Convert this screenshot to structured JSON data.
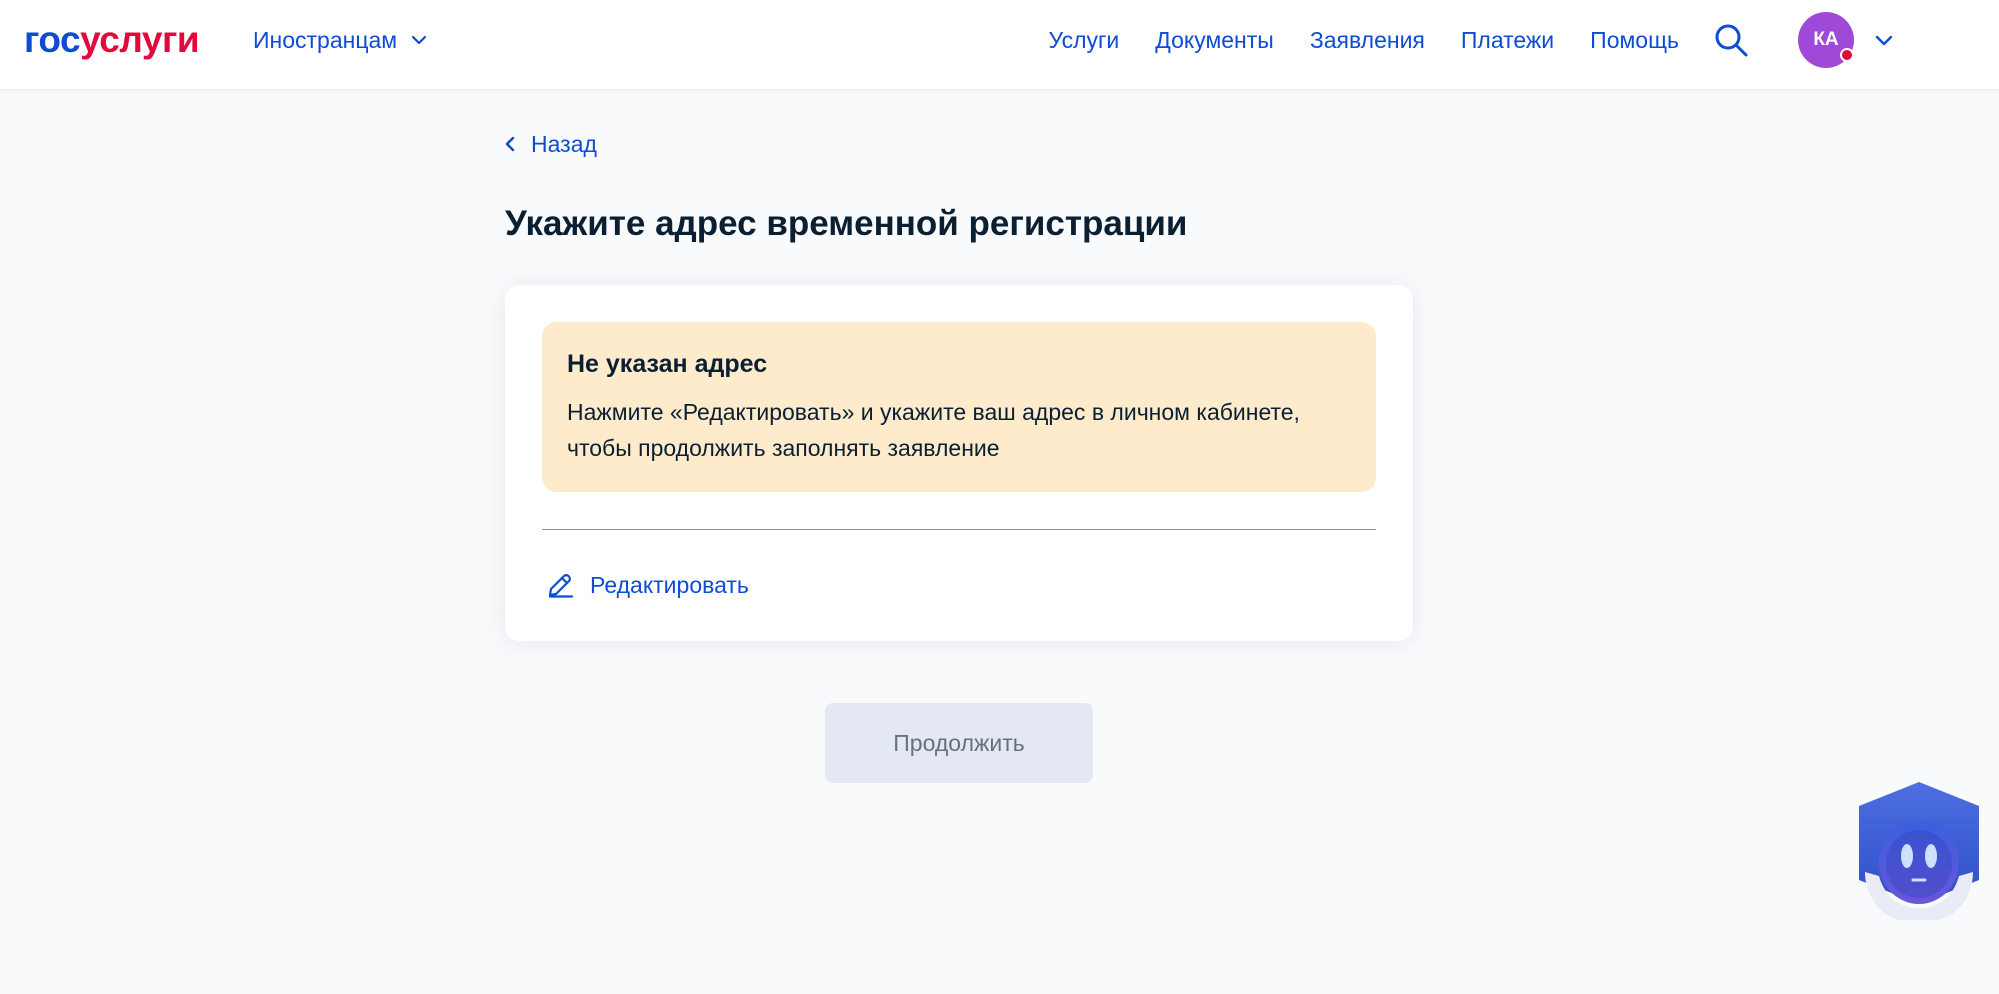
{
  "header": {
    "logo_part1": "гос",
    "logo_part2": "услуги",
    "audience_label": "Иностранцам",
    "nav": [
      "Услуги",
      "Документы",
      "Заявления",
      "Платежи",
      "Помощь"
    ],
    "avatar_initials": "КА"
  },
  "main": {
    "back_label": "Назад",
    "title": "Укажите адрес временной регистрации",
    "alert": {
      "title": "Не указан адрес",
      "text": "Нажмите «Редактировать» и укажите ваш адрес в личном кабинете, чтобы продолжить заполнять заявление"
    },
    "edit_label": "Редактировать",
    "continue_label": "Продолжить"
  },
  "icons": {
    "search": "search-icon",
    "chevron": "chevron-down-icon",
    "back": "chevron-left-icon",
    "edit": "pencil-icon",
    "assistant": "robot-assistant-icon"
  },
  "colors": {
    "accent": "#0d4cd3",
    "logo_red": "#e3093c",
    "alert_bg": "#feebcc",
    "avatar_bg": "#9e49d7",
    "button_disabled_bg": "#e4e8f2"
  }
}
